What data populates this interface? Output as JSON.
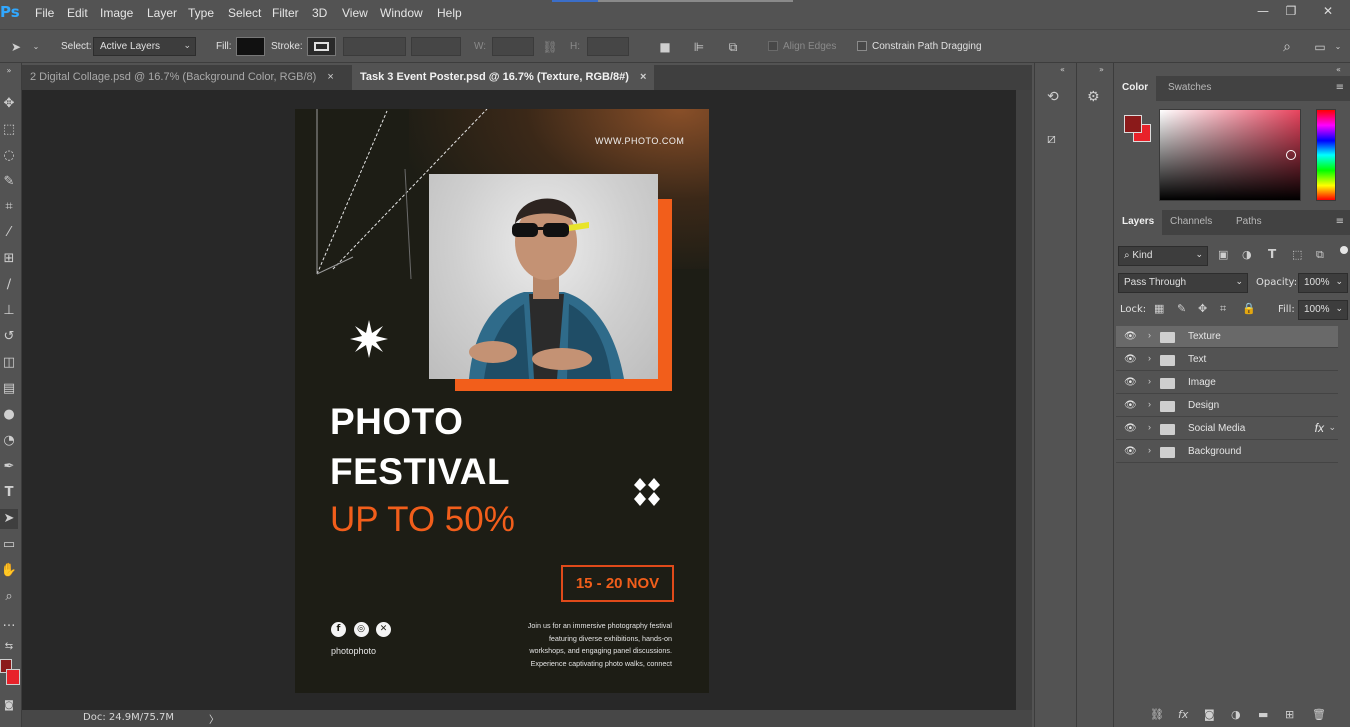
{
  "app": {
    "logo": "Ps"
  },
  "menu": [
    "File",
    "Edit",
    "Image",
    "Layer",
    "Type",
    "Select",
    "Filter",
    "3D",
    "View",
    "Window",
    "Help"
  ],
  "window_controls": {
    "minimize": "—",
    "restore": "❐",
    "close": "✕"
  },
  "options": {
    "select_label": "Select:",
    "select_value": "Active Layers",
    "fill_label": "Fill:",
    "stroke_label": "Stroke:",
    "w_label": "W:",
    "h_label": "H:",
    "align_edges": "Align Edges",
    "constrain_path": "Constrain Path Dragging"
  },
  "tabs": [
    {
      "label": "2 Digital Collage.psd @ 16.7% (Background Color, RGB/8)",
      "close": "×"
    },
    {
      "label": "Task 3 Event Poster.psd @ 16.7% (Texture, RGB/8#)",
      "close": "×"
    }
  ],
  "status": {
    "doc": "Doc: 24.9M/75.7M",
    "arrow": "〉"
  },
  "poster": {
    "url": "WWW.PHOTO.COM",
    "title_line1": "PHOTO",
    "title_line2": "FESTIVAL",
    "title_line3": "UP TO  50%",
    "date": "15 - 20 NOV",
    "handle": "photophoto",
    "body": [
      "Join us for an immersive photography festival",
      "featuring diverse exhibitions, hands-on",
      "workshops, and engaging panel discussions.",
      "Experience captivating photo walks, connect"
    ],
    "social": [
      "f",
      "◎",
      "✕"
    ],
    "colors": {
      "accent": "#f25e1b",
      "background": "#1d1d15"
    }
  },
  "color_panel": {
    "tabs": [
      "Color",
      "Swatches"
    ],
    "foreground": "#8b1a1a",
    "background": "#e8222a"
  },
  "layers_panel": {
    "tabs": [
      "Layers",
      "Channels",
      "Paths"
    ],
    "kind_label": "Kind",
    "blend_mode": "Pass Through",
    "opacity_label": "Opacity:",
    "opacity_value": "100%",
    "lock_label": "Lock:",
    "fill_label": "Fill:",
    "fill_value": "100%",
    "layers": [
      {
        "name": "Texture",
        "selected": true
      },
      {
        "name": "Text"
      },
      {
        "name": "Image"
      },
      {
        "name": "Design"
      },
      {
        "name": "Social Media",
        "fx": "fx"
      },
      {
        "name": "Background"
      }
    ]
  }
}
